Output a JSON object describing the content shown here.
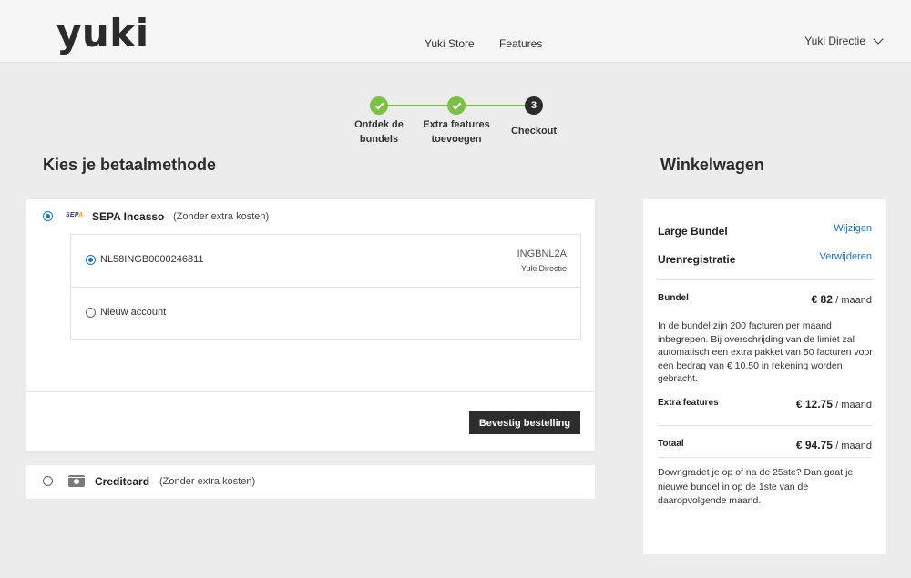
{
  "header": {
    "logo": "yuki",
    "nav": [
      "Yuki Store",
      "Features"
    ],
    "user": "Yuki Directie"
  },
  "stepper": {
    "steps": [
      {
        "label": "Ontdek de bundels",
        "state": "done"
      },
      {
        "label": "Extra features toevoegen",
        "state": "done"
      },
      {
        "label": "Checkout",
        "state": "current",
        "number": "3"
      }
    ]
  },
  "payment": {
    "title": "Kies je betaalmethode",
    "sepa": {
      "logo_text": "SEPA",
      "name": "SEPA Incasso",
      "note": "(Zonder extra kosten)",
      "selected": true,
      "accounts": [
        {
          "iban": "NL58INGB0000246811",
          "bic": "INGBNL2A",
          "holder": "Yuki Directie",
          "selected": true
        },
        {
          "label": "Nieuw account",
          "selected": false
        }
      ],
      "confirm_label": "Bevestig bestelling"
    },
    "creditcard": {
      "name": "Creditcard",
      "note": "(Zonder extra kosten)",
      "selected": false
    }
  },
  "cart": {
    "title": "Winkelwagen",
    "items": [
      {
        "name": "Large Bundel",
        "action": "Wijzigen"
      },
      {
        "name": "Urenregistratie",
        "action": "Verwijderen"
      }
    ],
    "bundle": {
      "label": "Bundel",
      "price": "€ 82",
      "unit": "/ maand",
      "description": "In de bundel zijn 200 facturen per maand inbegrepen. Bij overschrijding van de limiet zal automatisch een extra pakket van 50 facturen voor een bedrag van € 10.50 in rekening worden gebracht."
    },
    "extra": {
      "label": "Extra features",
      "price": "€ 12.75",
      "unit": "/ maand"
    },
    "total": {
      "label": "Totaal",
      "price": "€ 94.75",
      "unit": "/ maand"
    },
    "note": "Downgradet je op of na de 25ste? Dan gaat je nieuwe bundel in op de 1ste van de daaropvolgende maand.",
    "link_color": "#1a73c8"
  },
  "colors": {
    "step_done": "#7cbf45",
    "step_current": "#2b2b2b",
    "radio_selected": "#1a73c8",
    "button": "#2d2d2d"
  }
}
